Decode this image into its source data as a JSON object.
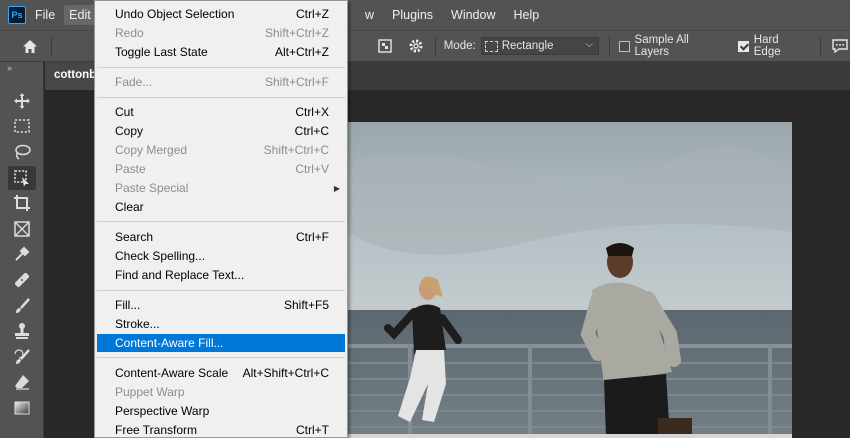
{
  "app": {
    "logo": "Ps"
  },
  "menubar": {
    "items_left": [
      "File",
      "Edit"
    ],
    "items_right": [
      "w",
      "Plugins",
      "Window",
      "Help"
    ],
    "active": "Edit"
  },
  "options": {
    "mode_label": "Mode:",
    "mode_value": "Rectangle",
    "sample_all_layers": "Sample All Layers",
    "sample_all_layers_checked": false,
    "hard_edge": "Hard Edge",
    "hard_edge_checked": true
  },
  "toolbar": {
    "collapse": "»",
    "tools": [
      "move-tool",
      "marquee-tool",
      "lasso-tool",
      "object-selection-tool",
      "crop-tool",
      "frame-tool",
      "eyedropper-tool",
      "healing-brush-tool",
      "brush-tool",
      "clone-stamp-tool",
      "history-brush-tool",
      "eraser-tool",
      "gradient-tool"
    ],
    "active_index": 3
  },
  "document": {
    "tab_title": "cottonb"
  },
  "edit_menu": {
    "items": [
      {
        "label": "Undo Object Selection",
        "shortcut": "Ctrl+Z",
        "disabled": false
      },
      {
        "label": "Redo",
        "shortcut": "Shift+Ctrl+Z",
        "disabled": true
      },
      {
        "label": "Toggle Last State",
        "shortcut": "Alt+Ctrl+Z",
        "disabled": false
      },
      {
        "label": "Fade...",
        "shortcut": "Shift+Ctrl+F",
        "disabled": true
      },
      {
        "label": "Cut",
        "shortcut": "Ctrl+X",
        "disabled": false
      },
      {
        "label": "Copy",
        "shortcut": "Ctrl+C",
        "disabled": false
      },
      {
        "label": "Copy Merged",
        "shortcut": "Shift+Ctrl+C",
        "disabled": true
      },
      {
        "label": "Paste",
        "shortcut": "Ctrl+V",
        "disabled": true
      },
      {
        "label": "Paste Special",
        "shortcut": "",
        "disabled": true,
        "submenu": true
      },
      {
        "label": "Clear",
        "shortcut": "",
        "disabled": false
      },
      {
        "label": "Search",
        "shortcut": "Ctrl+F",
        "disabled": false
      },
      {
        "label": "Check Spelling...",
        "shortcut": "",
        "disabled": false
      },
      {
        "label": "Find and Replace Text...",
        "shortcut": "",
        "disabled": false
      },
      {
        "label": "Fill...",
        "shortcut": "Shift+F5",
        "disabled": false
      },
      {
        "label": "Stroke...",
        "shortcut": "",
        "disabled": false
      },
      {
        "label": "Content-Aware Fill...",
        "shortcut": "",
        "disabled": false,
        "highlighted": true
      },
      {
        "label": "Content-Aware Scale",
        "shortcut": "Alt+Shift+Ctrl+C",
        "disabled": false
      },
      {
        "label": "Puppet Warp",
        "shortcut": "",
        "disabled": true
      },
      {
        "label": "Perspective Warp",
        "shortcut": "",
        "disabled": false
      },
      {
        "label": "Free Transform",
        "shortcut": "Ctrl+T",
        "disabled": false
      }
    ]
  },
  "colors": {
    "highlight": "#0078d7",
    "ui_gray": "#535353",
    "canvas_bg": "#282828"
  }
}
